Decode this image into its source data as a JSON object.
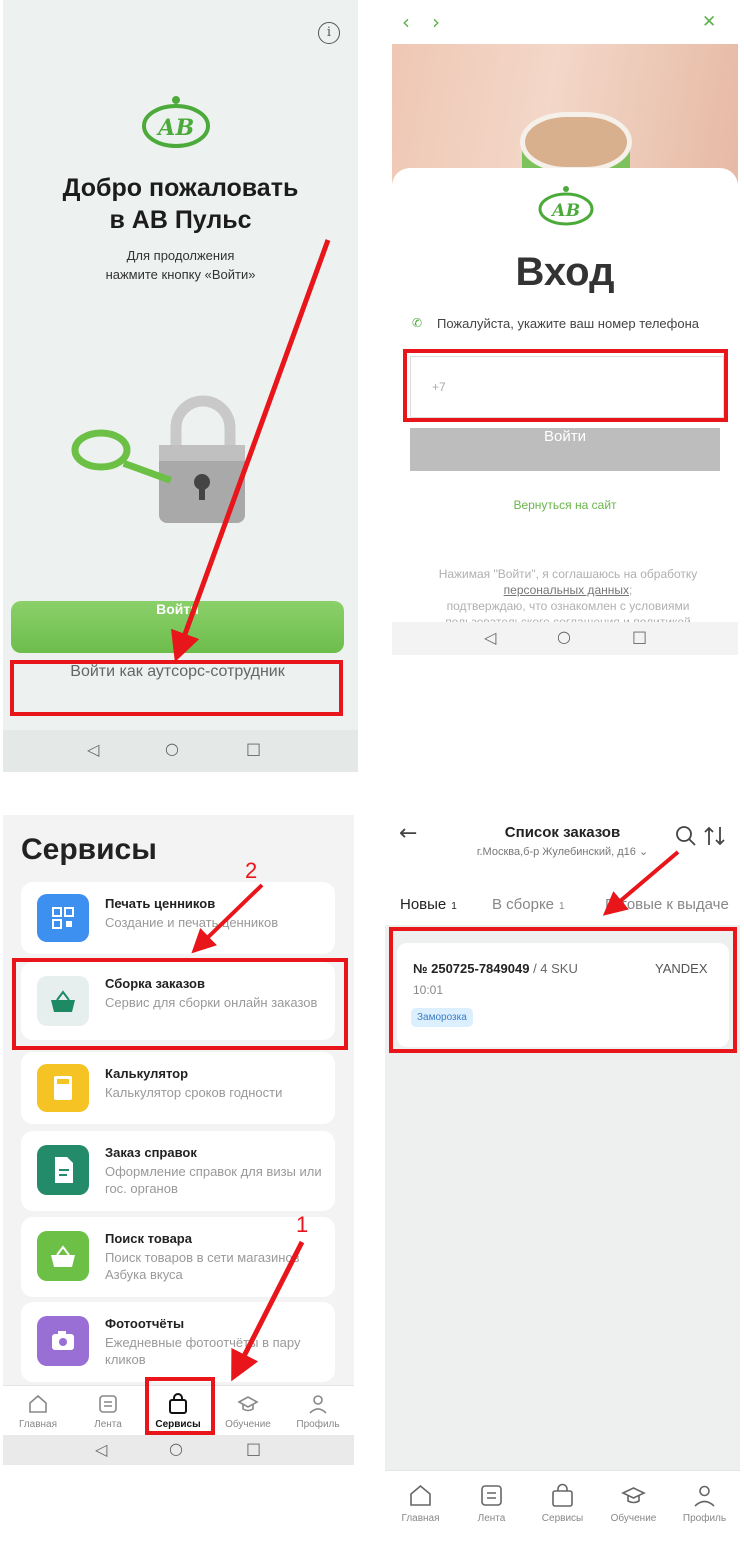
{
  "welcome": {
    "title_line1": "Добро пожаловать",
    "title_line2": "в АВ Пульс",
    "subtitle_line1": "Для продолжения",
    "subtitle_line2": "нажмите кнопку «Войти»",
    "login_button": "Войти",
    "outsource_button": "Войти как аутсорс-сотрудник"
  },
  "login": {
    "title": "Вход",
    "phone_hint": "Пожалуйста, укажите ваш номер телефона",
    "phone_value": "+7",
    "login_button": "Войти",
    "back_link": "Вернуться на сайт",
    "terms_line1": "Нажимая \"Войти\", я соглашаюсь на обработку",
    "terms_link": "персональных данных",
    "terms_line2": "подтверждаю, что ознакомлен с условиями",
    "terms_line3": "пользовательского соглашения и политикой"
  },
  "services": {
    "title": "Сервисы",
    "items": [
      {
        "name": "Печать ценников",
        "desc": "Создание и печать ценников",
        "color": "#3d8ff0",
        "icon": "qr-icon"
      },
      {
        "name": "Сборка заказов",
        "desc": "Сервис для сборки онлайн заказов",
        "color": "#e6eeee",
        "icon": "basket-icon"
      },
      {
        "name": "Калькулятор",
        "desc": "Калькулятор сроков годности",
        "color": "#f5c323",
        "icon": "calculator-icon"
      },
      {
        "name": "Заказ справок",
        "desc": "Оформление справок для визы или гос. органов",
        "color": "#238a6a",
        "icon": "document-icon"
      },
      {
        "name": "Поиск товара",
        "desc": "Поиск товаров в сети магазинов Азбука вкуса",
        "color": "#6cc045",
        "icon": "basket-search-icon"
      },
      {
        "name": "Фотоотчёты",
        "desc": "Ежедневные фотоотчёты в пару кликов",
        "color": "#9a6fd5",
        "icon": "camera-icon"
      }
    ]
  },
  "tabbar": {
    "items": [
      "Главная",
      "Лента",
      "Сервисы",
      "Обучение",
      "Профиль"
    ]
  },
  "orders": {
    "title": "Список заказов",
    "address": "г.Москва,б-р Жулебинский, д16",
    "tabs": [
      {
        "label": "Новые",
        "count": "1"
      },
      {
        "label": "В сборке",
        "count": "1"
      },
      {
        "label": "Готовые к выдаче",
        "count": ""
      }
    ],
    "order": {
      "number": "№ 250725-7849049",
      "sku": "/ 4 SKU",
      "provider": "YANDEX",
      "time": "10:01",
      "badge": "Заморозка"
    }
  },
  "annotations": {
    "step1": "1",
    "step2": "2"
  },
  "colors": {
    "brand_green": "#6dbd4c",
    "annotation_red": "#e8151b"
  }
}
